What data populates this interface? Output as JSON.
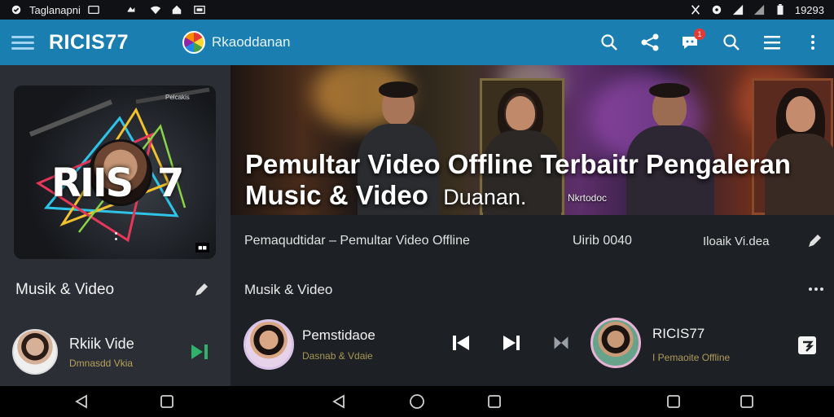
{
  "status_bar": {
    "left_text": "Taglanapni",
    "time": "19293",
    "icons": [
      "notification-dot-icon",
      "image-icon",
      "wifi-icon",
      "home-icon",
      "cast-icon",
      "no-sim-icon",
      "location-icon",
      "signal-icon",
      "battery-icon"
    ]
  },
  "app_bar": {
    "title": "RICIS77",
    "subtitle": "Rkaoddanan",
    "notification_count": "1",
    "actions": [
      "search-icon",
      "share-icon",
      "chat-icon",
      "search-icon",
      "list-icon",
      "more-vertical-icon"
    ]
  },
  "sidebar": {
    "album_art_text_left": "RIIS",
    "album_art_text_right": "7",
    "album_art_top_label": "Pelcakis",
    "section_title": "Musik & Video",
    "track": {
      "title": "Rkiik Vide",
      "subtitle": "Dmnasdd Vkia"
    }
  },
  "hero": {
    "title_line1": "Pemultar Video Offline Terbaitr  Pengaleran",
    "title_line2": "Music & Video",
    "title_line2_extra": "Duanan.",
    "small_label": "Nkrtodoc"
  },
  "info_row": {
    "left": "Pemaqudtidar – Pemultar Video Offline",
    "middle": "Uirib 0040",
    "right": "Iloaik Vi.dea"
  },
  "main": {
    "section_title": "Musik & Video",
    "now_playing_left": {
      "title": "Pemstidaoe",
      "subtitle": "Dasnab & Vdaie"
    },
    "now_playing_right": {
      "title": "RICIS77",
      "subtitle": "I Pemaoite Offline"
    }
  },
  "colors": {
    "app_bar": "#1a7fb0",
    "accent_green": "#2fb36b",
    "background": "#1d2024",
    "side_panel": "#2b2f35"
  }
}
